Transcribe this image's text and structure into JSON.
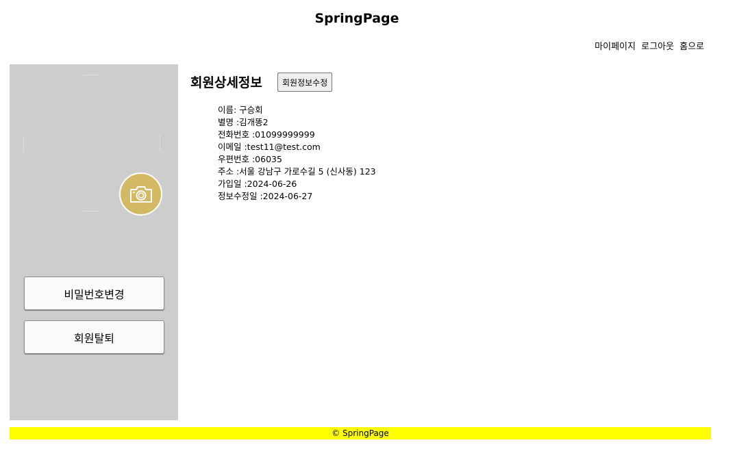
{
  "header": {
    "site_title": "SpringPage",
    "nav": {
      "mypage": "마이페이지",
      "logout": "로그아웃",
      "home": "홈으로"
    }
  },
  "sidebar": {
    "camera_icon": "camera-icon",
    "change_password_label": "비밀번호변경",
    "withdraw_label": "회원탈퇴"
  },
  "main": {
    "title": "회원상세정보",
    "edit_button": "회원정보수정",
    "info": [
      "이름: 구승회",
      "별명 :김개똥2",
      "전화번호 :01099999999",
      "이메일 :test11@test.com",
      "우편번호 :06035",
      "주소 :서울 강남구 가로수길 5 (신사동) 123",
      "가입일 :2024-06-26",
      "정보수정일 :2024-06-27"
    ]
  },
  "footer": {
    "copyright": "© SpringPage"
  },
  "colors": {
    "sidebar_bg": "#cecdcd",
    "camera_bg": "#d4b964",
    "footer_bg": "#ffff00"
  }
}
